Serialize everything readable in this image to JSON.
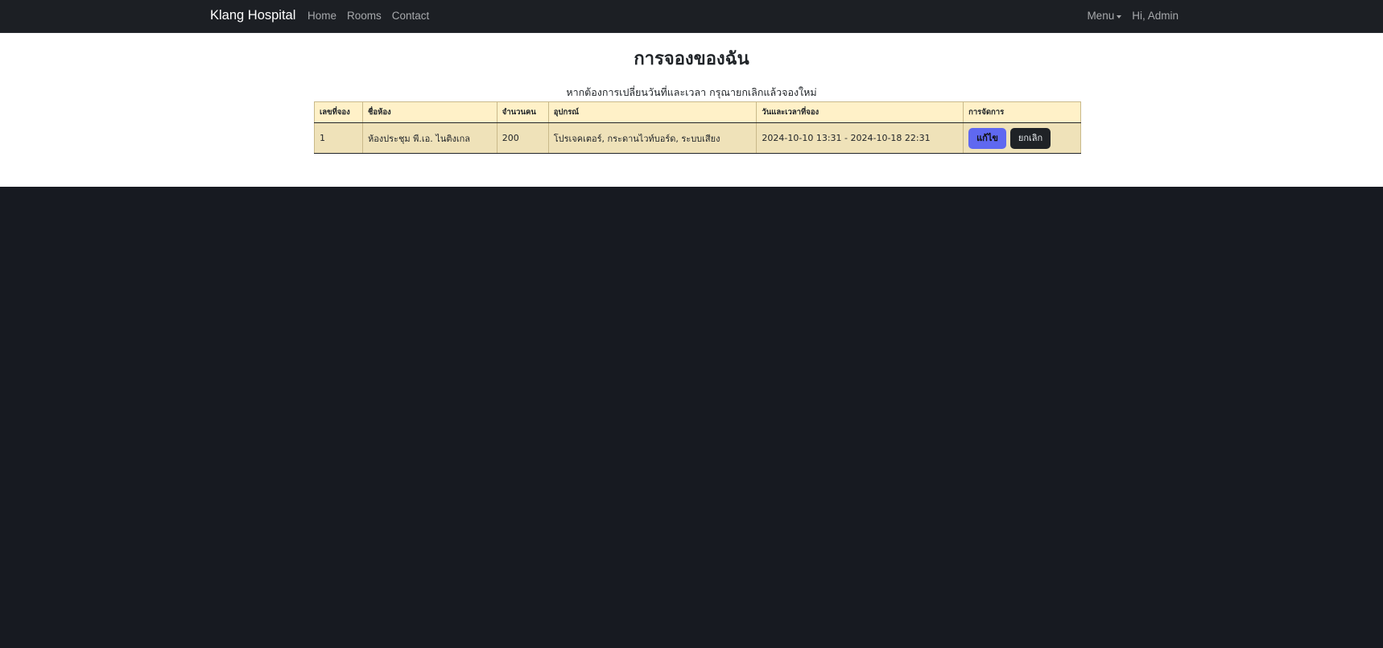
{
  "navbar": {
    "brand": "Klang Hospital",
    "links": [
      "Home",
      "Rooms",
      "Contact"
    ],
    "menu_label": "Menu",
    "greeting": "Hi, Admin"
  },
  "page": {
    "title": "การจองของฉัน",
    "notice": "หากต้องการเปลี่ยนวันที่และเวลา กรุณายกเลิกแล้วจองใหม่"
  },
  "table": {
    "headers": [
      "เลขที่จอง",
      "ชื่อห้อง",
      "จำนวนคน",
      "อุปกรณ์",
      "วันและเวลาที่จอง",
      "การจัดการ"
    ],
    "rows": [
      {
        "id": "1",
        "room": "ห้องประชุม พี.เอ. ไนติงเกล",
        "capacity": "200",
        "equipment": "โปรเจคเตอร์, กระดานไวท์บอร์ด, ระบบเสียง",
        "datetime": "2024-10-10 13:31 - 2024-10-18 22:31",
        "edit_label": "แก้ไข",
        "cancel_label": "ยกเลิก"
      }
    ]
  },
  "colors": {
    "navbar_bg": "#1c1f24",
    "footer_bg": "#171a21",
    "header_row_bg": "#fff1c8",
    "body_row_bg": "#efe2b9",
    "edit_button": "#5f68f0",
    "cancel_button": "#1f2226"
  }
}
